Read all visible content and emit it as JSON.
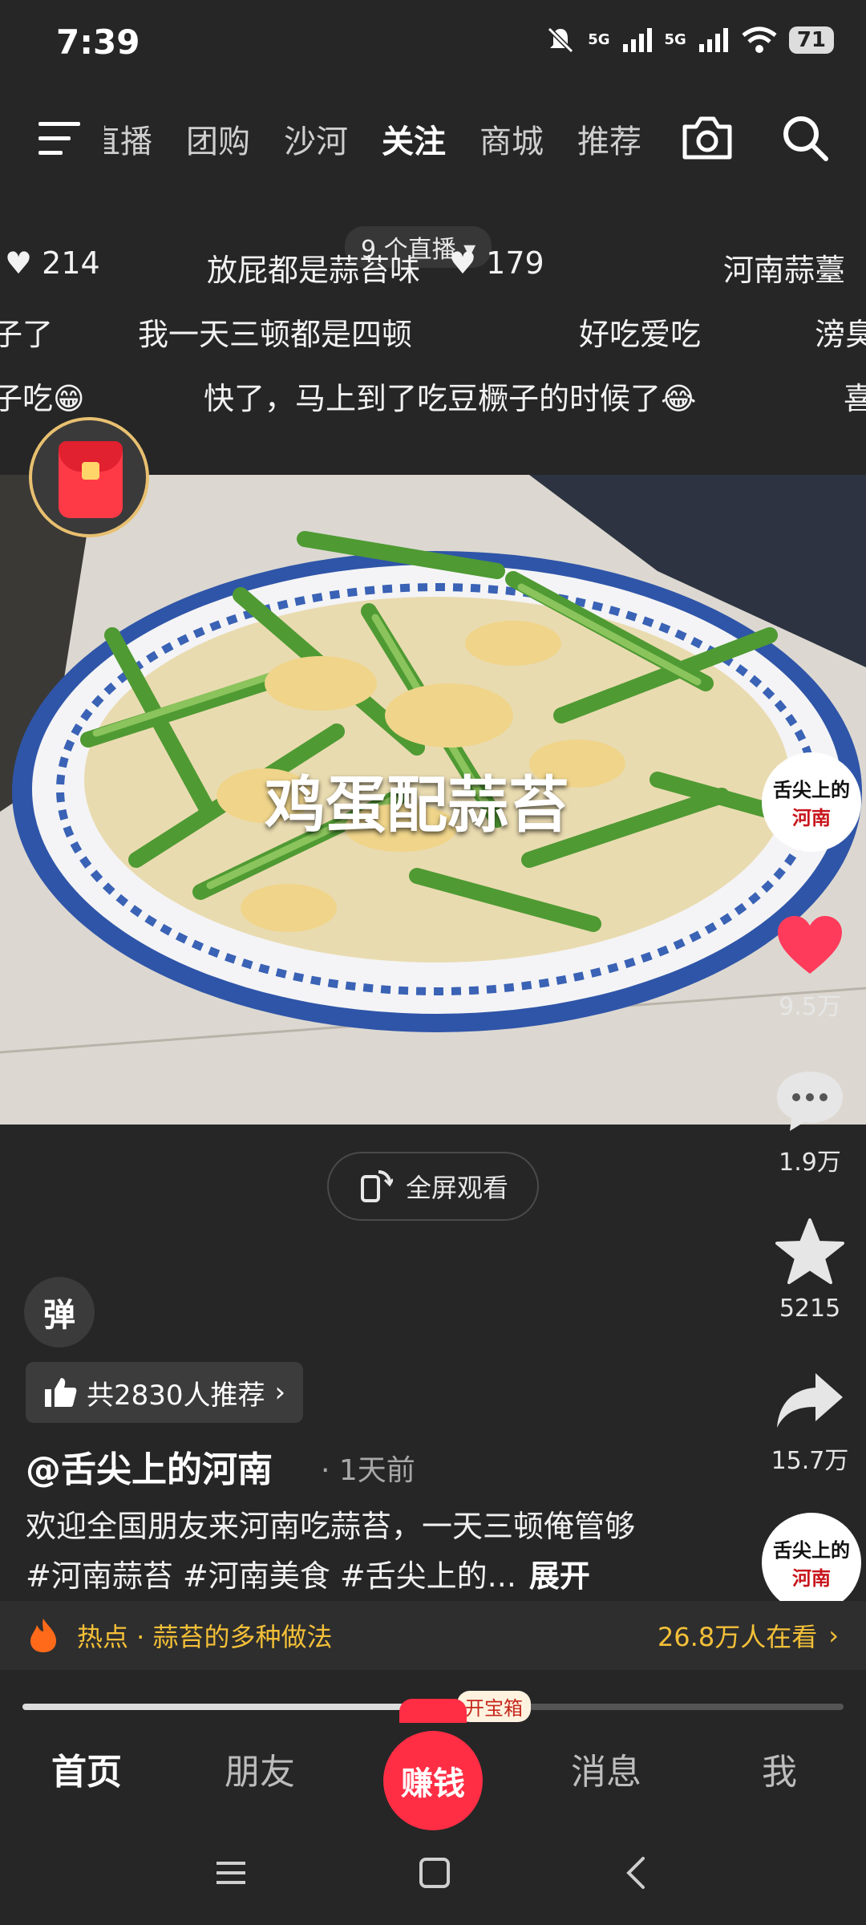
{
  "status_bar": {
    "time": "7:39",
    "signal_1": "5G",
    "signal_2": "5G",
    "battery": "71"
  },
  "top_nav": {
    "tabs": [
      "直播",
      "团购",
      "沙河",
      "关注",
      "商城",
      "推荐"
    ],
    "active_tab": "关注"
  },
  "danmaku": {
    "live_pill": "9 个直播",
    "row1": [
      {
        "like": true,
        "text": "214"
      },
      {
        "text": "放屁都是蒜苔味"
      },
      {
        "like": true,
        "text": "179"
      },
      {
        "text": "河南蒜薹"
      }
    ],
    "row2": [
      "子了",
      "我一天三顿都是四顿",
      "好吃爱吃",
      "滂臭"
    ],
    "row3": [
      "子吃",
      "快了，马上到了吃豆橛子的时候了",
      "喜"
    ]
  },
  "video": {
    "title_overlay": "鸡蛋配蒜苔"
  },
  "right_rail": {
    "avatar_text_top": "舌尖上的",
    "avatar_text_main": "河南",
    "likes": "9.5万",
    "comments": "1.9万",
    "favorites": "5215",
    "shares": "15.7万"
  },
  "fullscreen_label": "全屏观看",
  "danmaku_toggle": "弹",
  "recommend": "共2830人推荐",
  "author": "@舌尖上的河南",
  "posted": "· 1天前",
  "description": "欢迎全国朋友来河南吃蒜苔，一天三顿俺管够#河南蒜苔 #河南美食 #舌尖上的...",
  "expand": "展开",
  "hot": {
    "label": "热点 · 蒜苔的多种做法",
    "viewers": "26.8万人在看"
  },
  "progress_percent": 52,
  "chest_label": "开宝箱",
  "bottom_nav": {
    "home": "首页",
    "friends": "朋友",
    "earn": "赚钱",
    "messages": "消息",
    "me": "我"
  },
  "colors": {
    "background": "#262626",
    "like_red": "#ff3b5c",
    "hot_yellow": "#f4c038",
    "earn_red": "#ff2e45"
  }
}
